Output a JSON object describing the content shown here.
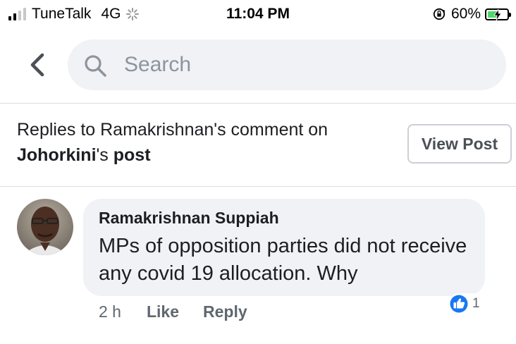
{
  "status_bar": {
    "carrier": "TuneTalk",
    "network": "4G",
    "time": "11:04 PM",
    "battery_percent": "60%",
    "battery_level": 0.6,
    "signal_bars_active": 2,
    "signal_bars_total": 4
  },
  "search": {
    "placeholder": "Search",
    "value": ""
  },
  "header": {
    "prefix": "Replies to Ramakrishnan's comment on",
    "page_name": "Johorkini",
    "possessive": "'s",
    "post_word": "post",
    "view_post_label": "View Post"
  },
  "comment": {
    "author": "Ramakrishnan Suppiah",
    "text": "MPs of opposition parties did not receive any covid 19 allocation. Why",
    "time": "2 h",
    "like_label": "Like",
    "reply_label": "Reply",
    "reaction_count": "1",
    "reaction_icon": "like-icon"
  },
  "colors": {
    "accent": "#1877f2",
    "bubble": "#f0f2f5",
    "secondary_text": "#606770",
    "battery": "#4cd964"
  }
}
